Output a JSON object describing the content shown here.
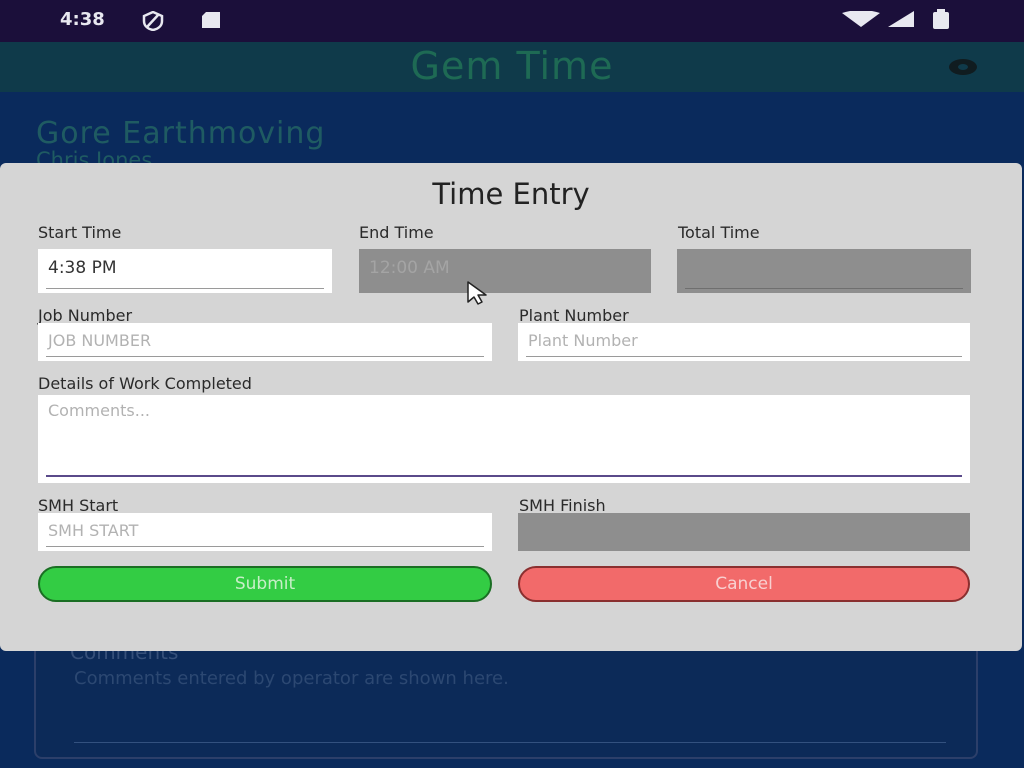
{
  "status_bar": {
    "time": "4:38",
    "icons": [
      "vpn-shield-icon",
      "sd-card-icon",
      "wifi-icon",
      "cellular-signal-icon",
      "battery-icon"
    ]
  },
  "app_bar": {
    "title": "Gem Time",
    "settings_icon": "gear-icon"
  },
  "background": {
    "company": "Gore Earthmoving",
    "person": "Chris Jones",
    "comments_label": "Comments",
    "comments_hint": "Comments entered by operator are shown here."
  },
  "dialog": {
    "title": "Time Entry",
    "start_time": {
      "label": "Start Time",
      "value": "4:38 PM"
    },
    "end_time": {
      "label": "End Time",
      "placeholder": "12:00 AM"
    },
    "total_time": {
      "label": "Total Time",
      "value": ""
    },
    "job_number": {
      "label": "Job Number",
      "placeholder": "JOB NUMBER"
    },
    "plant_number": {
      "label": "Plant Number",
      "placeholder": "Plant Number"
    },
    "details": {
      "label": "Details of Work Completed",
      "placeholder": "Comments..."
    },
    "smh_start": {
      "label": "SMH Start",
      "placeholder": "SMH START"
    },
    "smh_finish": {
      "label": "SMH Finish",
      "value": ""
    },
    "submit_label": "Submit",
    "cancel_label": "Cancel"
  },
  "colors": {
    "status_bar": "#1b0f3a",
    "app_bar": "#0f3a4a",
    "page_background": "#0a2a5c",
    "dialog_background": "#d5d5d5",
    "disabled_field": "#8e8e8e",
    "submit": "#33cc44",
    "cancel": "#f26a6a"
  }
}
